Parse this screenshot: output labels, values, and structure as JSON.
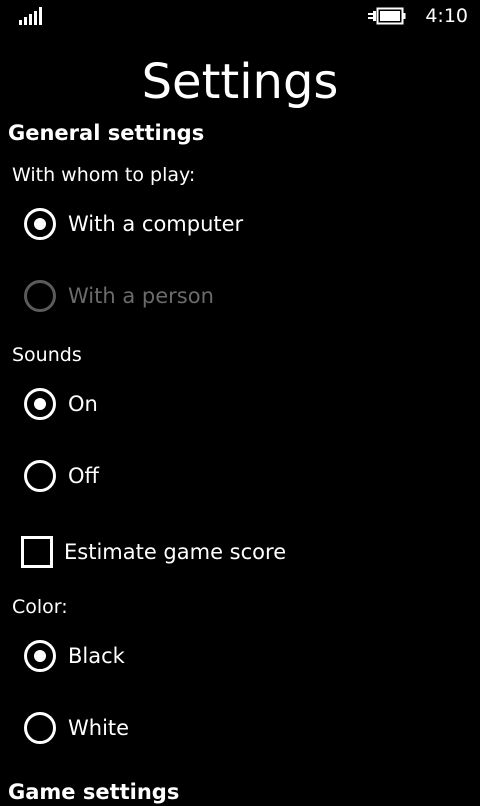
{
  "status_bar": {
    "time": "4:10",
    "signal_icon": "signal-bars-icon",
    "battery_icon": "battery-charging-icon"
  },
  "page": {
    "title": "Settings"
  },
  "sections": {
    "general": {
      "header": "General settings",
      "opponent": {
        "label": "With whom to play:",
        "options": [
          {
            "label": "With a computer",
            "selected": true,
            "enabled": true
          },
          {
            "label": "With a person",
            "selected": false,
            "enabled": false
          }
        ]
      },
      "sounds": {
        "label": "Sounds",
        "options": [
          {
            "label": "On",
            "selected": true,
            "enabled": true
          },
          {
            "label": "Off",
            "selected": false,
            "enabled": true
          }
        ]
      },
      "estimate_score": {
        "label": "Estimate game score",
        "checked": false
      },
      "color": {
        "label": "Color:",
        "options": [
          {
            "label": "Black",
            "selected": true,
            "enabled": true
          },
          {
            "label": "White",
            "selected": false,
            "enabled": true
          }
        ]
      }
    },
    "game": {
      "header": "Game settings"
    }
  },
  "colors": {
    "background": "#000000",
    "foreground": "#ffffff",
    "disabled": "#6b6b6b"
  }
}
